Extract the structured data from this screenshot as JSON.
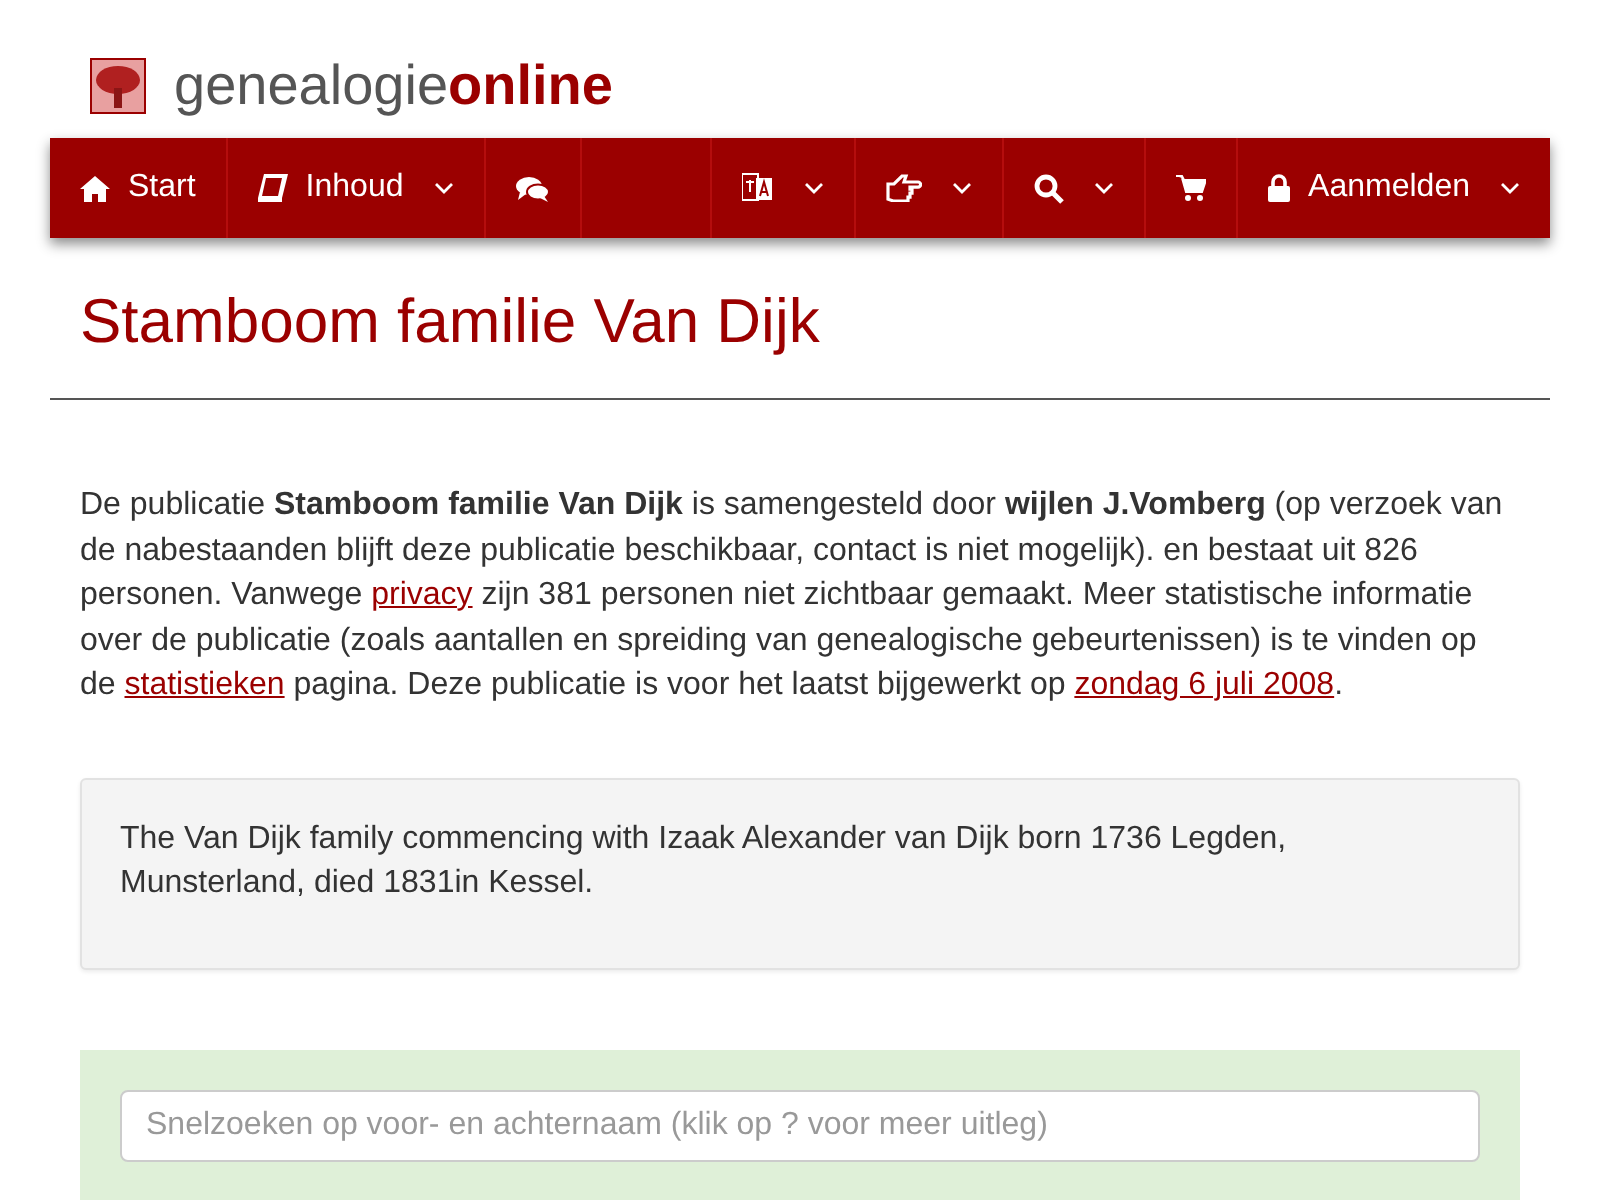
{
  "logo": {
    "text_plain": "genealogie",
    "text_bold": "online"
  },
  "nav": [
    {
      "kind": "home",
      "label": "Start",
      "caret": false
    },
    {
      "kind": "book",
      "label": "Inhoud",
      "caret": true
    },
    {
      "kind": "chat",
      "caret": false
    },
    {
      "kind": "spacer"
    },
    {
      "kind": "translate",
      "caret": true
    },
    {
      "kind": "hand",
      "caret": true
    },
    {
      "kind": "search",
      "caret": true
    },
    {
      "kind": "cart",
      "caret": false
    },
    {
      "kind": "lock",
      "label": "Aanmelden",
      "caret": true
    }
  ],
  "title": "Stamboom familie Van Dijk",
  "intro": [
    {
      "kind": "text",
      "text": "De publicatie **Stamboom familie Van Dijk** is samengesteld door **wijlen J.Vomberg** (op verzoek van de nabestaanden blijft deze publicatie beschikbaar, contact is niet mogelijk). en bestaat uit 826 personen. Vanwege "
    },
    {
      "kind": "link",
      "text": "privacy"
    },
    {
      "kind": "text",
      "text": " zijn 381 personen niet zichtbaar gemaakt. Meer statistische informatie over de publicatie (zoals aantallen en spreiding van genealogische gebeurtenissen) is te vinden op de "
    },
    {
      "kind": "link",
      "text": "statistieken"
    },
    {
      "kind": "text",
      "text": " pagina. Deze publicatie is voor het laatst bijgewerkt op "
    },
    {
      "kind": "link",
      "text": "zondag 6 juli 2008"
    },
    {
      "kind": "text",
      "text": "."
    }
  ],
  "description": "The Van Dijk family commencing with Izaak Alexander van Dijk born 1736 Legden, Munsterland, died 1831in Kessel.",
  "quick_search": {
    "placeholder": "Snelzoeken op voor- en achternaam (klik op ? voor meer uitleg)"
  }
}
